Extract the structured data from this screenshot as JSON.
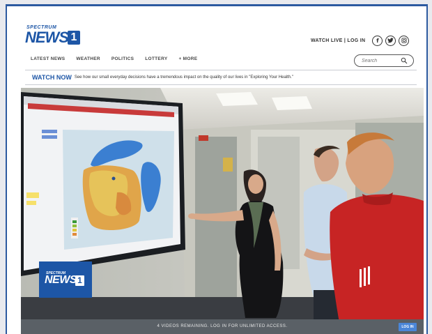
{
  "brand": {
    "spectrum": "SPECTRUM",
    "news": "NEWS",
    "one": "1"
  },
  "header": {
    "watch_live_login": "WATCH LIVE | LOG IN"
  },
  "social": [
    {
      "name": "facebook-icon",
      "glyph": "f"
    },
    {
      "name": "twitter-icon",
      "glyph": "t"
    },
    {
      "name": "instagram-icon",
      "glyph": "◎"
    }
  ],
  "nav": [
    "LATEST NEWS",
    "WEATHER",
    "POLITICS",
    "LOTTERY",
    "+ MORE"
  ],
  "search": {
    "placeholder": "Search"
  },
  "watch_now": {
    "label": "WATCH NOW",
    "text": "See how our small everyday decisions have a tremendous impact on the quality of our lives in \"Exploring Your Health.\""
  },
  "video": {
    "overlay_logo": {
      "spectrum": "SPECTRUM",
      "news": "NEWS",
      "one": "1"
    },
    "status": "4 VIDEOS REMAINING. LOG IN FOR UNLIMITED ACCESS.",
    "login_button": "LOG IN"
  },
  "colors": {
    "brand_blue": "#1d56a6",
    "bar_gray": "#5a6066",
    "login_blue": "#4a86d8"
  }
}
